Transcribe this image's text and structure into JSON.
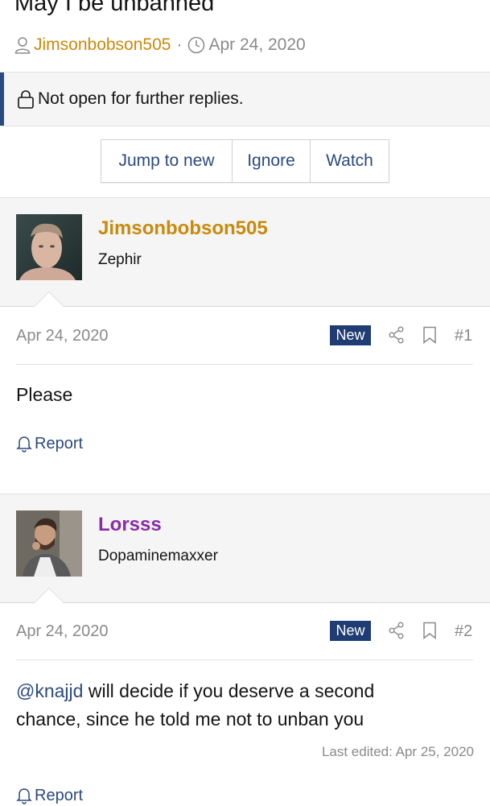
{
  "thread": {
    "title": "May I be unbanned",
    "author": "Jimsonbobson505",
    "separator": "·",
    "date": "Apr 24, 2020"
  },
  "notice": {
    "text": "Not open for further replies."
  },
  "actions": {
    "jump": "Jump to new",
    "ignore": "Ignore",
    "watch": "Watch"
  },
  "posts": [
    {
      "username": "Jimsonbobson505",
      "user_title": "Zephir",
      "username_color": "#c98a0c",
      "date": "Apr 24, 2020",
      "badge": "New",
      "number": "#1",
      "body": "Please",
      "report": "Report"
    },
    {
      "username": "Lorsss",
      "user_title": "Dopaminemaxxer",
      "username_color": "#8a2aa8",
      "date": "Apr 24, 2020",
      "badge": "New",
      "number": "#2",
      "mention": "@knajjd",
      "body_line1": " will decide if you deserve a second",
      "body_line2": "chance, since he told me not to unban you",
      "last_edited": "Last edited: Apr 25, 2020",
      "report": "Report"
    }
  ],
  "colors": {
    "accent": "#2b4a7f",
    "badge": "#1f3d73",
    "muted": "#8a8a8a"
  }
}
